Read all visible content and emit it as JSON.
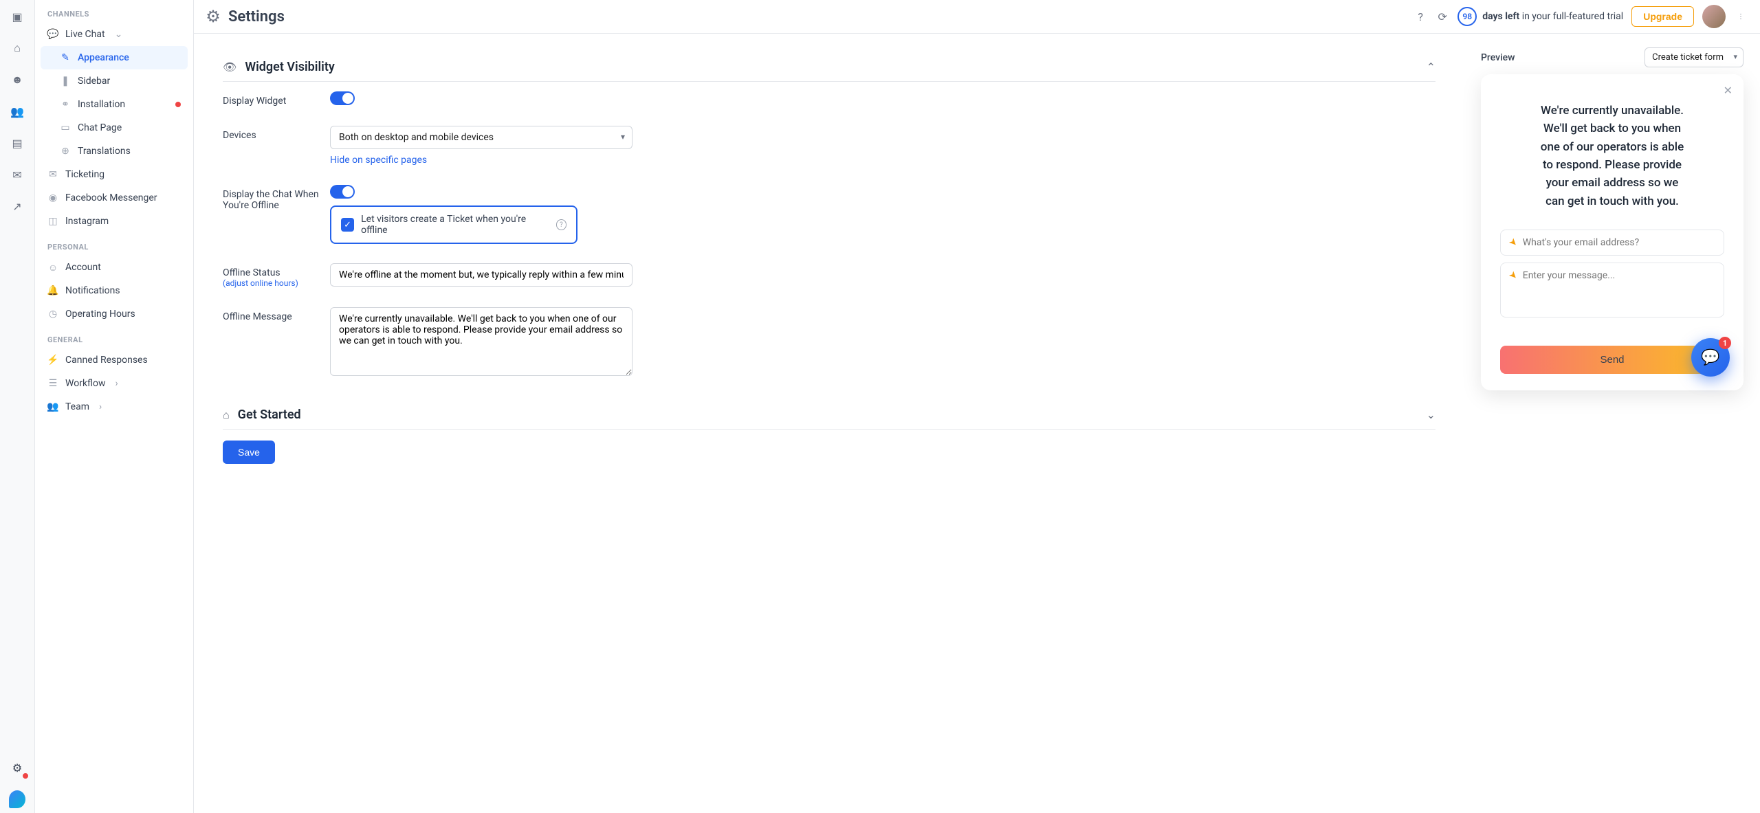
{
  "header": {
    "title": "Settings",
    "trial_days": "98",
    "trial_text_bold": "days left",
    "trial_text_rest": " in your full-featured trial",
    "upgrade": "Upgrade"
  },
  "sidebar": {
    "section_channels": "CHANNELS",
    "live_chat": "Live Chat",
    "appearance": "Appearance",
    "sidebar_item": "Sidebar",
    "installation": "Installation",
    "chat_page": "Chat Page",
    "translations": "Translations",
    "ticketing": "Ticketing",
    "fb_messenger": "Facebook Messenger",
    "instagram": "Instagram",
    "section_personal": "PERSONAL",
    "account": "Account",
    "notifications": "Notifications",
    "operating_hours": "Operating Hours",
    "section_general": "GENERAL",
    "canned_responses": "Canned Responses",
    "workflow": "Workflow",
    "team": "Team"
  },
  "form": {
    "section_visibility": "Widget Visibility",
    "display_widget": "Display Widget",
    "devices_label": "Devices",
    "devices_value": "Both on desktop and mobile devices",
    "hide_pages": "Hide on specific pages",
    "display_offline": "Display the Chat When You're Offline",
    "create_ticket": "Let visitors create a Ticket when you're offline",
    "offline_status_label": "Offline Status",
    "offline_status_sub": "(adjust online hours)",
    "offline_status_value": "We're offline at the moment but, we typically reply within a few minutes.",
    "offline_message_label": "Offline Message",
    "offline_message_value": "We're currently unavailable. We'll get back to you when one of our operators is able to respond. Please provide your email address so we can get in touch with you.",
    "section_get_started": "Get Started",
    "save": "Save"
  },
  "preview": {
    "label": "Preview",
    "select": "Create ticket form",
    "msg_line1": "We're currently unavailable.",
    "msg_line2": "We'll get back to you when",
    "msg_line3": "one of our operators is able",
    "msg_line4": "to respond. Please provide",
    "msg_line5": "your email address so we",
    "msg_line6": "can get in touch with you.",
    "email_placeholder": "What's your email address?",
    "message_placeholder": "Enter your message...",
    "send": "Send",
    "fab_badge": "1"
  }
}
